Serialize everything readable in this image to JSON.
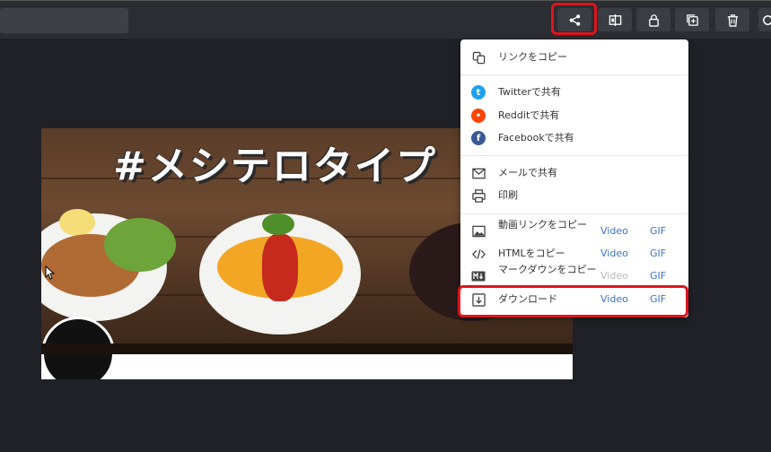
{
  "toolbar": {
    "buttons": [
      {
        "name": "share-icon",
        "title": "Share"
      },
      {
        "name": "compare-icon",
        "title": "Compare"
      },
      {
        "name": "lock-icon",
        "title": "Lock"
      },
      {
        "name": "duplicate-icon",
        "title": "Duplicate"
      },
      {
        "name": "trash-icon",
        "title": "Delete"
      }
    ]
  },
  "banner": {
    "title": "#メシテロタイプ"
  },
  "share_menu": {
    "copy_link": "リンクをコピー",
    "twitter": "Twitterで共有",
    "reddit": "Redditで共有",
    "facebook": "Facebookで共有",
    "email": "メールで共有",
    "print": "印刷",
    "video_link": "動画リンクをコピー",
    "html": "HTMLをコピー",
    "markdown": "マークダウンをコピー",
    "download": "ダウンロード",
    "video_label": "Video",
    "gif_label": "GIF"
  },
  "colors": {
    "highlight": "#e0141b",
    "link": "#3b73c9",
    "twitter": "#1da1f2",
    "reddit": "#ff4500",
    "facebook": "#3b5998"
  }
}
